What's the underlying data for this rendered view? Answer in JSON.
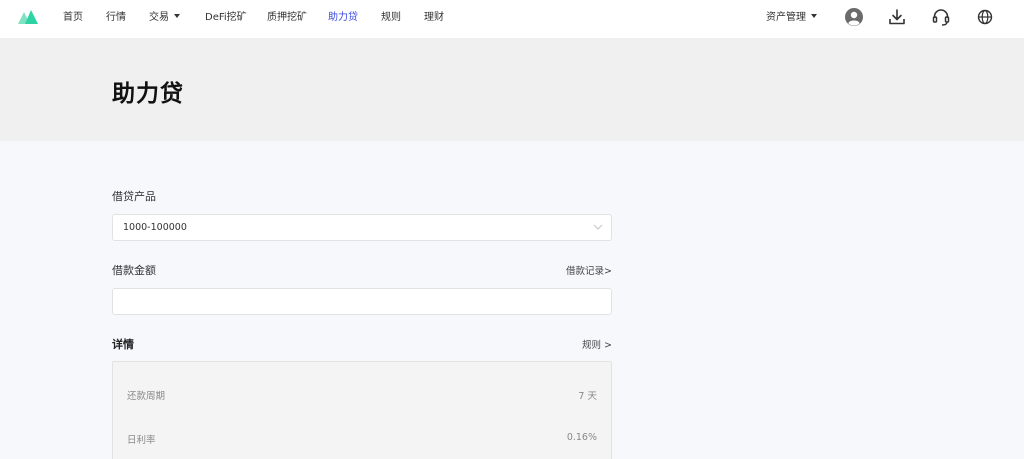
{
  "nav": {
    "items": [
      {
        "label": "首页"
      },
      {
        "label": "行情"
      },
      {
        "label": "交易"
      },
      {
        "label": "DeFi挖矿"
      },
      {
        "label": "质押挖矿"
      },
      {
        "label": "助力贷"
      },
      {
        "label": "规则"
      },
      {
        "label": "理财"
      }
    ],
    "asset_management": "资产管理"
  },
  "icons": {
    "logo": "logo-icon",
    "user": "user-icon",
    "download": "download-icon",
    "support": "headset-icon",
    "language": "globe-icon"
  },
  "colors": {
    "accent": "#3a47e0",
    "logo": "#2ed3a4"
  },
  "page": {
    "title": "助力贷"
  },
  "form": {
    "product_label": "借贷产品",
    "product_value": "1000-100000",
    "amount_label": "借款金额",
    "loan_record_link": "借款记录>",
    "amount_value": "",
    "amount_placeholder": ""
  },
  "details": {
    "title": "详情",
    "rules_link": "规则 >",
    "rows": [
      {
        "label": "还款周期",
        "value": "7 天"
      },
      {
        "label": "日利率",
        "value": "0.16%"
      }
    ]
  }
}
